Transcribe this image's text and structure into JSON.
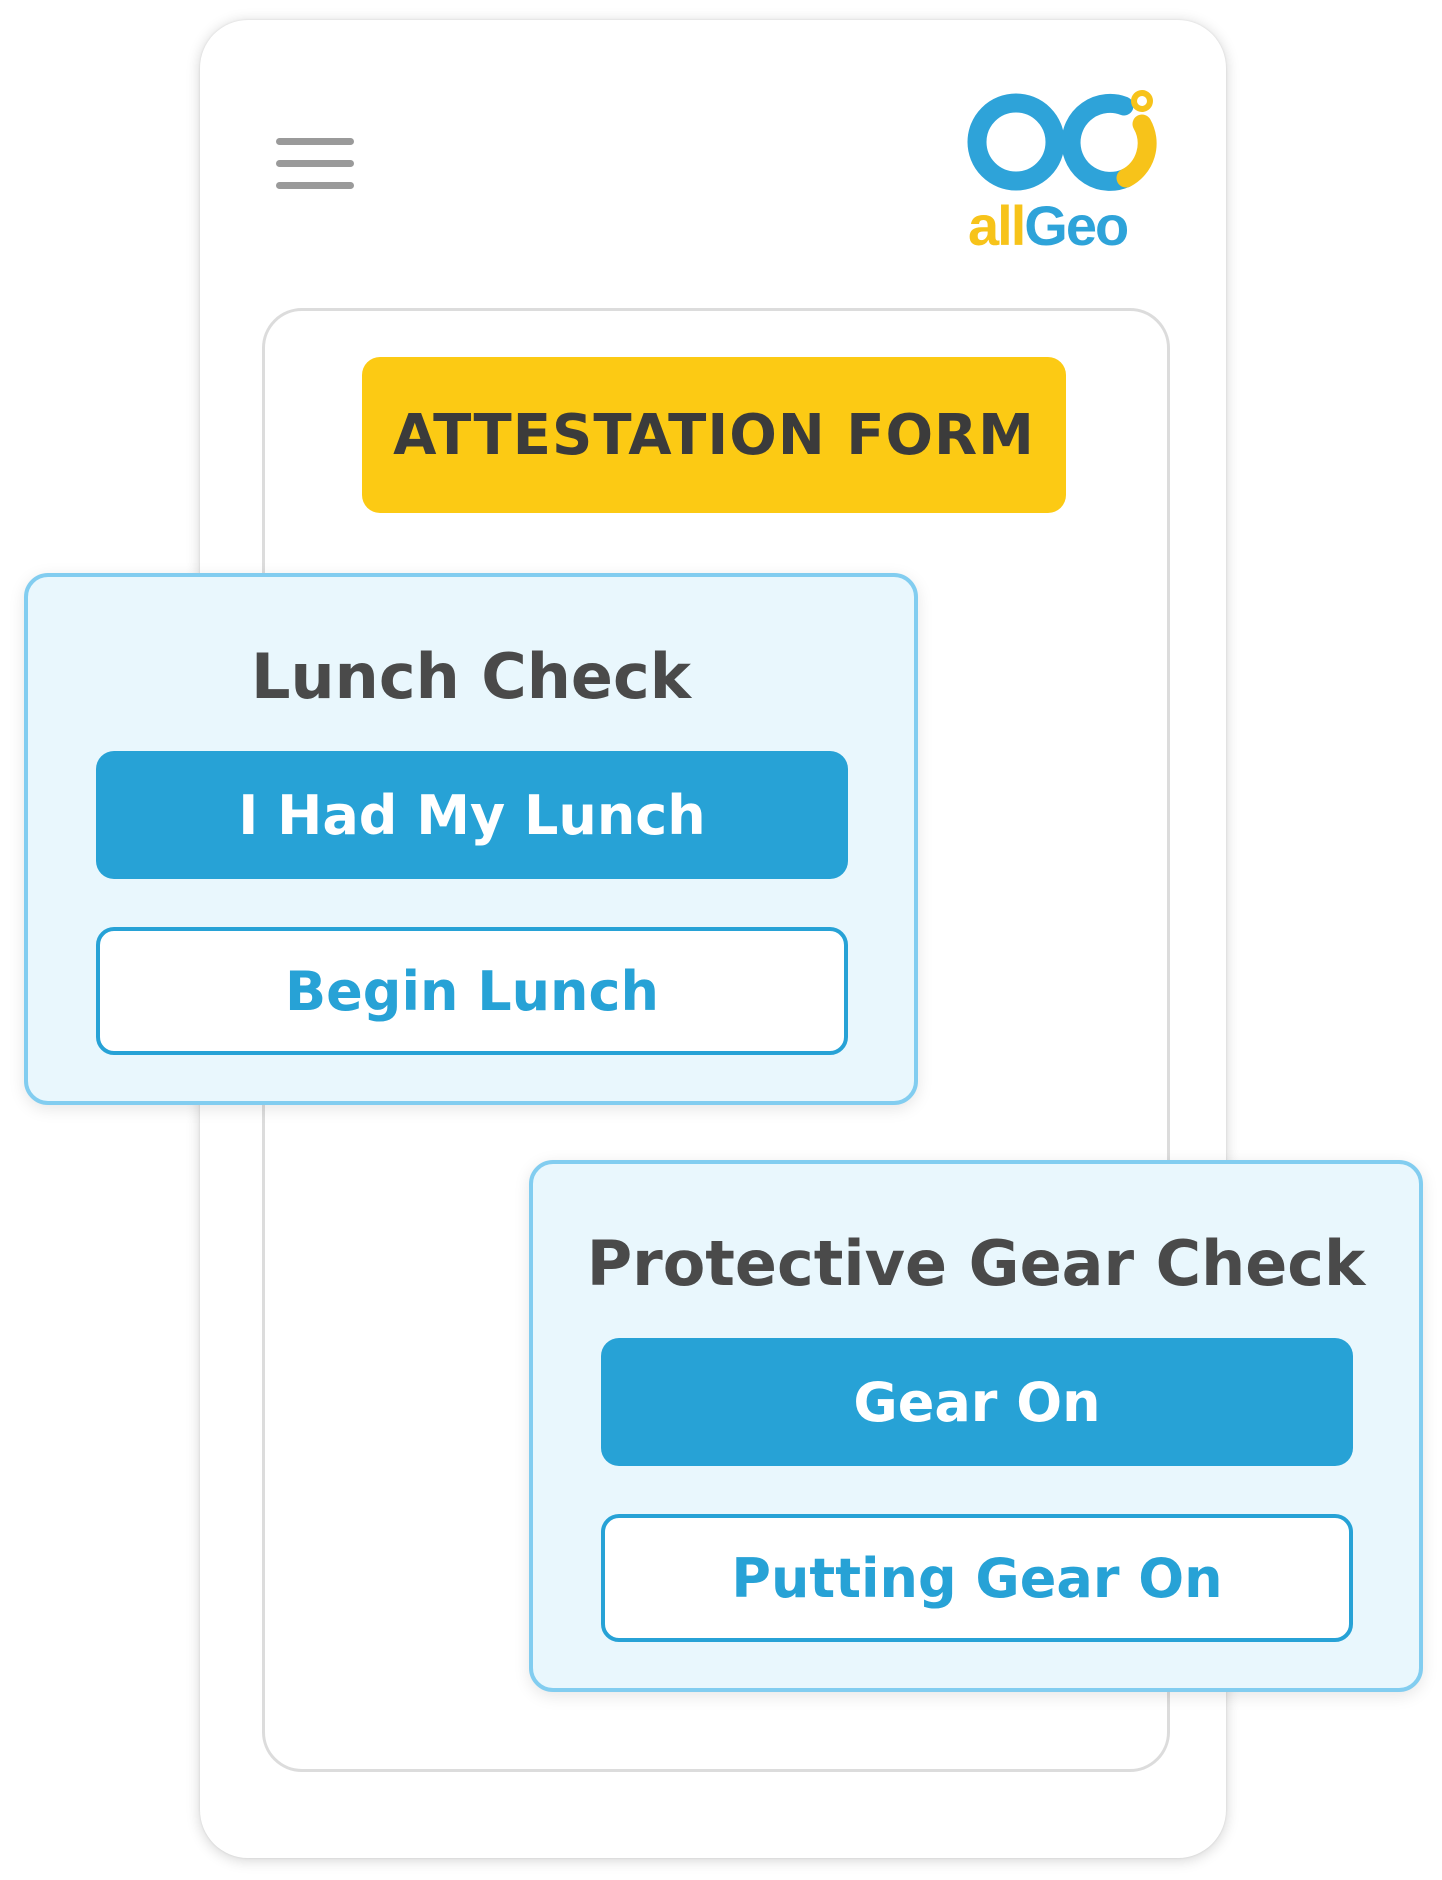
{
  "header": {
    "menu_icon": "hamburger-menu-icon",
    "logo": {
      "text_part1": "all",
      "text_part2": "Geo",
      "colors": {
        "yellow": "#f7c31a",
        "blue": "#2ea3d9"
      }
    }
  },
  "form": {
    "title": "ATTESTATION FORM",
    "banner_color": "#fcca14"
  },
  "cards": {
    "lunch": {
      "title": "Lunch Check",
      "primary_label": "I Had My Lunch",
      "secondary_label": "Begin Lunch"
    },
    "gear": {
      "title": "Protective Gear Check",
      "primary_label": "Gear On",
      "secondary_label": "Putting Gear On"
    }
  },
  "colors": {
    "accent": "#27a2d6",
    "card_background": "#e9f7fd",
    "card_border": "#82cdf0",
    "text_dark": "#4a4a4a"
  }
}
